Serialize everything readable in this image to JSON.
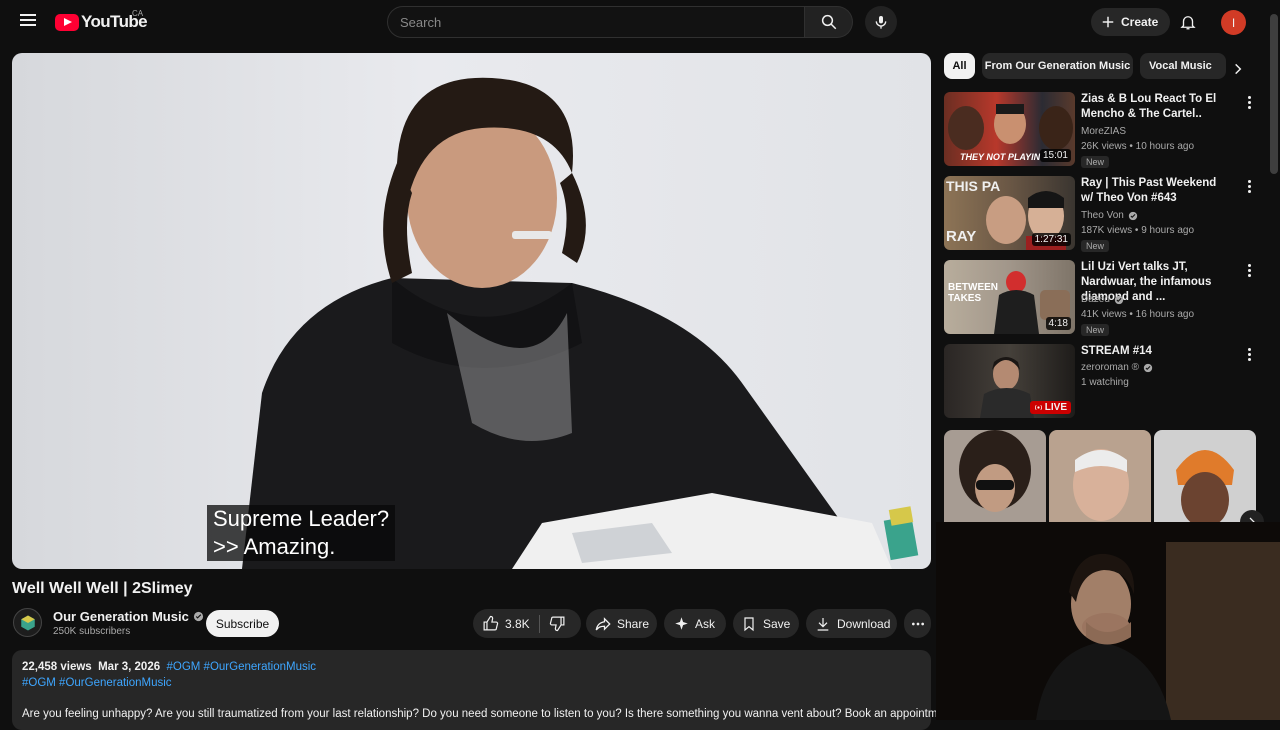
{
  "header": {
    "logo_text": "YouTube",
    "country_code": "CA",
    "search_placeholder": "Search",
    "create_label": "Create",
    "avatar_letter": "I"
  },
  "player": {
    "subtitle_lines": [
      "Supreme Leader?",
      ">> Amazing."
    ]
  },
  "video": {
    "title": "Well Well Well | 2Slimey",
    "channel_name": "Our Generation Music",
    "channel_subs": "250K subscribers",
    "subscribe_label": "Subscribe",
    "likes": "3.8K",
    "share_label": "Share",
    "ask_label": "Ask",
    "save_label": "Save",
    "download_label": "Download"
  },
  "description": {
    "views": "22,458 views",
    "date": "Mar 3, 2026",
    "hashtags_line1": "#OGM #OurGenerationMusic",
    "hashtags_line2": "#OGM #OurGenerationMusic",
    "body": "Are you feeling unhappy? Are you still traumatized from your last relationship? Do you need someone to listen to you? Is there something you wanna vent about? Book an appointment"
  },
  "chips": [
    "All",
    "From Our Generation Music",
    "Vocal Music"
  ],
  "recommendations": [
    {
      "title": "Zias & B Lou React To El Mencho & The Cartel..",
      "channel": "MoreZIAS",
      "verified": false,
      "stats": "26K views • 10 hours ago",
      "badge": "New",
      "duration": "15:01",
      "thumb_text": "THEY NOT PLAYIN"
    },
    {
      "title": "Ray | This Past Weekend w/ Theo Von #643",
      "channel": "Theo Von",
      "verified": true,
      "stats": "187K views • 9 hours ago",
      "badge": "New",
      "duration": "1:27:31",
      "thumb_text": "RAY"
    },
    {
      "title": "Lil Uzi Vert talks JT, Nardwuar, the infamous diamond and ...",
      "channel": "Dazed",
      "verified": true,
      "stats": "41K views • 16 hours ago",
      "badge": "New",
      "duration": "4:18",
      "thumb_text": "BETWEEN TAKES"
    },
    {
      "title": "STREAM #14",
      "channel": "zeroroman ®",
      "verified": true,
      "stats": "1 watching",
      "badge": "",
      "duration": "LIVE",
      "thumb_text": ""
    }
  ],
  "colors": {
    "background": "#0f0f0f",
    "accent_red": "#ff0033",
    "link_blue": "#3ea6ff",
    "pill_bg": "#272727"
  }
}
